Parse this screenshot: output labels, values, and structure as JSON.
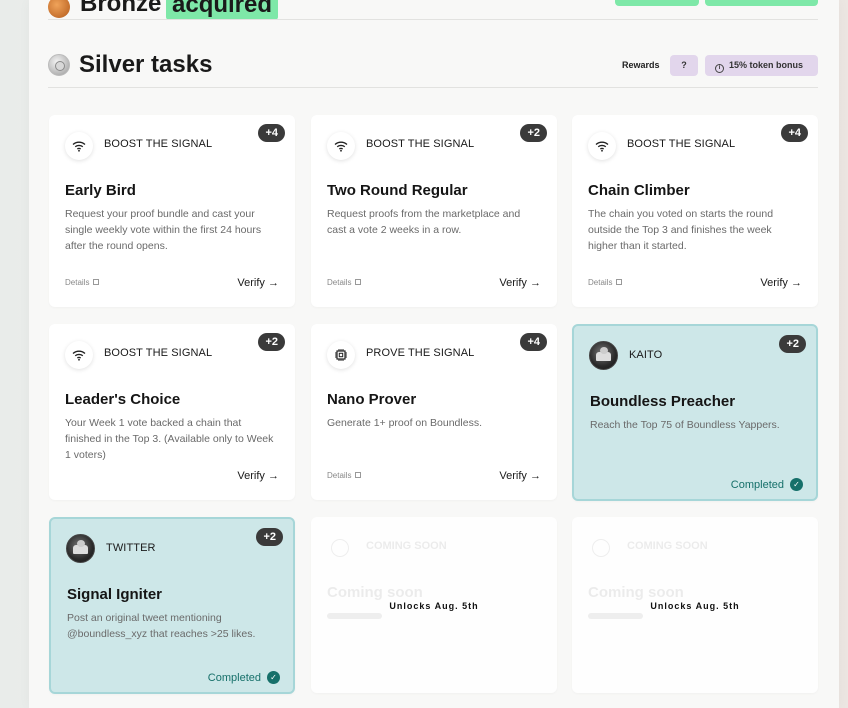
{
  "top_section": {
    "title": "Bronze",
    "badge": "acquired"
  },
  "section": {
    "title": "Silver tasks",
    "rewards_label": "Rewards",
    "reward_pill": "?",
    "bonus_pill": "15% token bonus"
  },
  "cards": [
    {
      "category": "BOOST THE SIGNAL",
      "icon": "wifi-icon",
      "points": "+4",
      "title": "Early Bird",
      "desc": "Request your proof bundle and cast your single weekly vote within the first 24 hours after the round opens.",
      "details": "Details",
      "action": "Verify"
    },
    {
      "category": "BOOST THE SIGNAL",
      "icon": "wifi-icon",
      "points": "+2",
      "title": "Two Round Regular",
      "desc": "Request proofs from the marketplace and cast a vote 2 weeks in a row.",
      "details": "Details",
      "action": "Verify"
    },
    {
      "category": "BOOST THE SIGNAL",
      "icon": "wifi-icon",
      "points": "+4",
      "title": "Chain Climber",
      "desc": "The chain you voted on starts the round outside the Top 3 and finishes the week higher than it started.",
      "details": "Details",
      "action": "Verify"
    },
    {
      "category": "BOOST THE SIGNAL",
      "icon": "wifi-icon",
      "points": "+2",
      "title": "Leader's Choice",
      "desc": "Your Week 1 vote backed a chain that finished in the Top 3. (Available only to Week 1 voters)",
      "action": "Verify"
    },
    {
      "category": "PROVE THE SIGNAL",
      "icon": "chip-icon",
      "points": "+4",
      "title": "Nano Prover",
      "desc": "Generate 1+ proof on Boundless.",
      "details": "Details",
      "action": "Verify"
    },
    {
      "category": "KAITO",
      "icon": "avatar",
      "points": "+2",
      "title": "Boundless Preacher",
      "desc": "Reach the Top 75 of Boundless Yappers.",
      "status": "Completed"
    },
    {
      "category": "TWITTER",
      "icon": "avatar",
      "points": "+2",
      "title": "Signal Igniter",
      "desc": "Post an original tweet mentioning @boundless_xyz that reaches >25 likes.",
      "status": "Completed"
    },
    {
      "category": "COMING SOON",
      "title": "Coming soon",
      "unlocks": "Unlocks Aug. 5th"
    },
    {
      "category": "COMING SOON",
      "title": "Coming soon",
      "unlocks": "Unlocks Aug. 5th"
    }
  ],
  "colors": {
    "accent_green": "#7ee8a8",
    "reward_purple": "#e2d6ec",
    "completed_bg": "#cde7e8",
    "completed_text": "#16706a",
    "points_bg": "#3a3a3a"
  }
}
